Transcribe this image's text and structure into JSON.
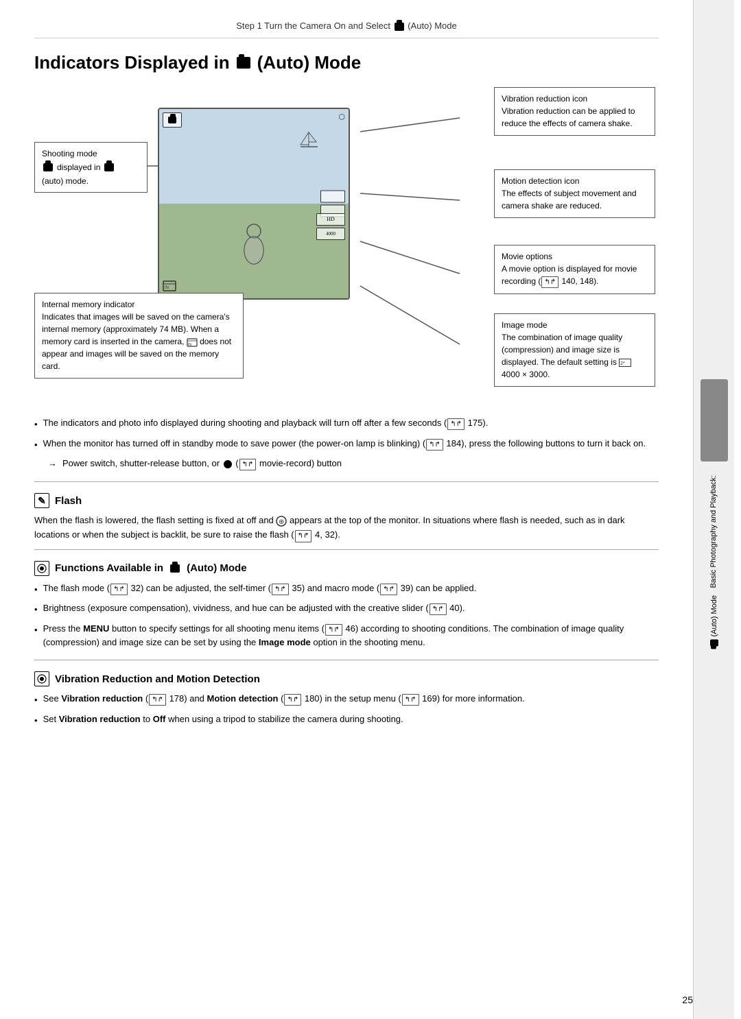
{
  "header": {
    "text": "Step 1 Turn the Camera On and Select",
    "mode": "(Auto) Mode"
  },
  "page_title": "Indicators Displayed in",
  "page_title_mode": "(Auto) Mode",
  "callouts": {
    "shooting": {
      "title": "Shooting mode",
      "body": "displayed in (auto) mode."
    },
    "memory": {
      "title": "Internal memory indicator",
      "body": "Indicates that images will be saved on the camera's internal memory (approximately 74 MB). When a memory card is inserted in the camera, does not appear and images will be saved on the memory card."
    },
    "vibration": {
      "title": "Vibration reduction icon",
      "body": "Vibration reduction can be applied to reduce the effects of camera shake."
    },
    "motion": {
      "title": "Motion detection icon",
      "body": "The effects of subject movement and camera shake are reduced."
    },
    "movie": {
      "title": "Movie options",
      "body": "A movie option is displayed for movie recording (  140, 148)."
    },
    "image_mode": {
      "title": "Image mode",
      "body": "The combination of image quality (compression) and image size is displayed. The default setting is  4000 × 3000."
    }
  },
  "bullets": {
    "main_note_1": "The indicators and photo info displayed during shooting and playback will turn off after a few seconds (  175).",
    "main_note_2": "When the monitor has turned off in standby mode to save power (the power-on lamp is blinking) (  184), press the following buttons to turn it back on.",
    "main_note_arrow": "→ Power switch, shutter-release button, or   (  movie-record) button"
  },
  "flash_section": {
    "heading": "Flash",
    "body": "When the flash is lowered, the flash setting is fixed at off and   appears at the top of the monitor. In situations where flash is needed, such as in dark locations or when the subject is backlit, be sure to raise the flash (  4, 32)."
  },
  "functions_section": {
    "heading": "Functions Available in",
    "heading_mode": "(Auto) Mode",
    "bullet1": "The flash mode (  32) can be adjusted, the self-timer (  35) and macro mode (  39) can be applied.",
    "bullet2": "Brightness (exposure compensation), vividness, and hue can be adjusted with the creative slider (  40).",
    "bullet3": "Press the MENU button to specify settings for all shooting menu items (  46) according to shooting conditions. The combination of image quality (compression) and image size can be set by using the Image mode option in the shooting menu."
  },
  "vibration_section": {
    "heading": "Vibration Reduction and Motion Detection",
    "bullet1": "See Vibration reduction (  178) and Motion detection (  180) in the setup menu (  169) for more information.",
    "bullet2": "Set Vibration reduction to Off when using a tripod to stabilize the camera during shooting."
  },
  "sidebar": {
    "top_label": "Basic Photography and Playback:",
    "bottom_label": "(Auto) Mode"
  },
  "page_number": "25"
}
